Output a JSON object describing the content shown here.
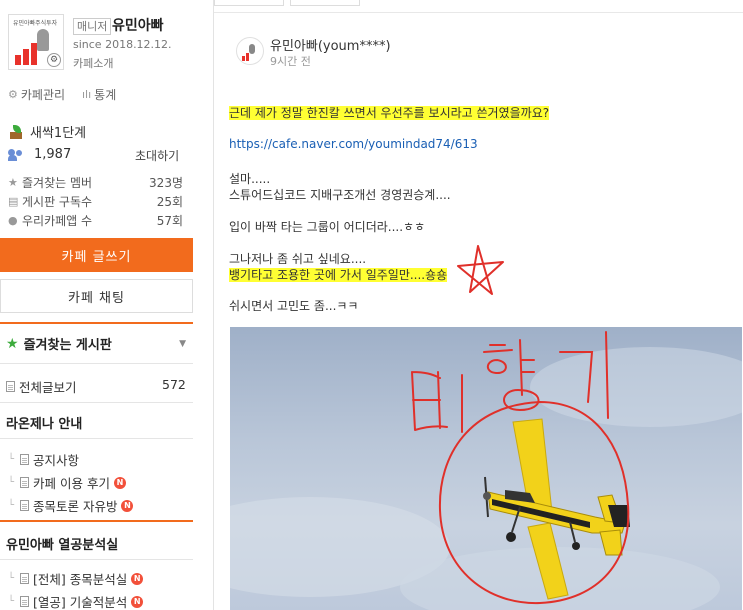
{
  "sidebar": {
    "logo_text": "유민아빠주식투자",
    "manager_badge": "매니저",
    "cafe_owner": "유민아빠",
    "since": "since 2018.12.12.",
    "intro": "카페소개",
    "cafe_manage": "카페관리",
    "stats": "통계",
    "level": "새싹1단계",
    "member_count": "1,987",
    "invite": "초대하기",
    "stat_rows": [
      {
        "label": "즐겨찾는 멤버",
        "value": "323명"
      },
      {
        "label": "게시판 구독수",
        "value": "25회"
      },
      {
        "label": "우리카페앱 수",
        "value": "57회"
      }
    ],
    "write_button": "카페 글쓰기",
    "chat_button": "카페 채팅",
    "favorites_title": "즐겨찾는 게시판",
    "all_posts": "전체글보기",
    "all_posts_count": "572",
    "group1_title": "라온제나 안내",
    "group1_items": [
      "공지사항",
      "카페 이용 후기",
      "종목토론 자유방"
    ],
    "group2_title": "유민아빠 열공분석실",
    "group2_items": [
      "[전체] 종목분석실",
      "[열공] 기술적분석"
    ],
    "new_badge": "N"
  },
  "post": {
    "author": "유민아빠(youm****)",
    "time": "9시간 전",
    "lines": [
      "근데 제가 정말 한진칼 쓰면서 우선주를 보시라고 쓴거였을까요?",
      "https://cafe.naver.com/youmindad74/613",
      "설마.....",
      "스튜어드십코드 지배구조개선 경영권승계....",
      "입이 바짝 타는 그룹이 어디더라....ㅎㅎ",
      "그나저나 좀 쉬고 싶네요....",
      "뱅기타고 조용한 곳에 가서 일주일만....숑숑",
      "쉬시면서 고민도 좀...ㅋㅋ"
    ],
    "handwritten_label": "비행기"
  },
  "colors": {
    "accent": "#f26b1d",
    "highlight": "#ffff33",
    "link": "#1a5fb4",
    "annotation_red": "#e0302a",
    "plane_yellow": "#f2d21a"
  }
}
